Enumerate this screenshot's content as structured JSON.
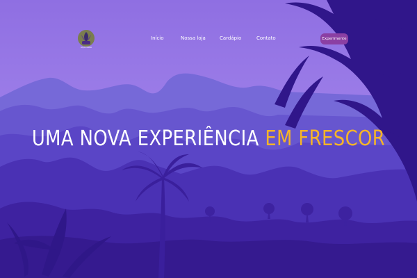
{
  "brand": {
    "logo_icon": "plant-logo-icon",
    "caption": "AÇAITERIA"
  },
  "nav": {
    "items": [
      {
        "label": "Início"
      },
      {
        "label": "Nossa loja"
      },
      {
        "label": "Cardápio"
      },
      {
        "label": "Contato"
      }
    ],
    "cta_label": "Experimente"
  },
  "hero": {
    "headline_part1": "UMA NOVA EXPERIÊNCIA",
    "headline_part2": "EM FRESCOR"
  },
  "colors": {
    "sky": "#8d6fe0",
    "mountains": "#5b42c4",
    "foreground": "#3b1f96",
    "accent": "#f5b428",
    "cta": "#8b3fa3"
  }
}
